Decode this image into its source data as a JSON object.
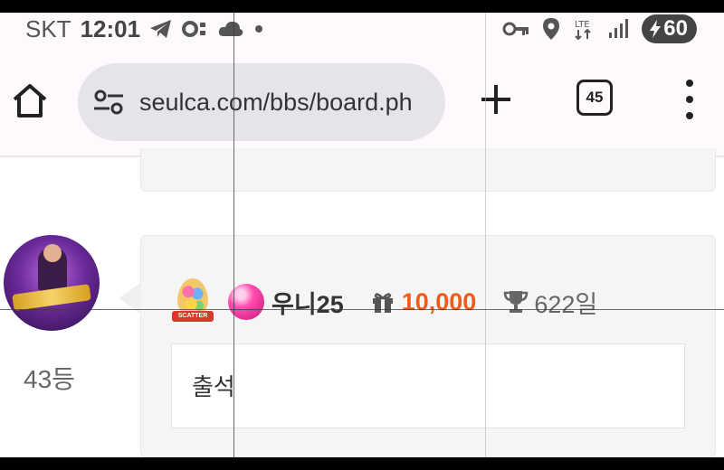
{
  "status_bar": {
    "carrier": "SKT",
    "time": "12:01",
    "battery": "60",
    "icons_left": [
      "telegram-icon",
      "settings-notification-icon",
      "cloud-icon",
      "dot-icon"
    ],
    "icons_right": [
      "key-icon",
      "location-icon",
      "data-arrows-icon",
      "signal-icon",
      "charging-icon"
    ]
  },
  "browser": {
    "url": "seulca.com/bbs/board.ph",
    "tab_count": "45",
    "icons": [
      "home-icon",
      "site-settings-icon",
      "plus-icon",
      "tabs-icon",
      "more-vert-icon"
    ]
  },
  "comment": {
    "rank": "43등",
    "badge_label": "SCATTER",
    "nickname": "우니25",
    "points": "10,000",
    "days": "622일",
    "text": "출석",
    "colors": {
      "points": "#f05a1a",
      "card_bg": "#f5f5f5",
      "nickname_level_ball": "#ff4fb0"
    }
  }
}
